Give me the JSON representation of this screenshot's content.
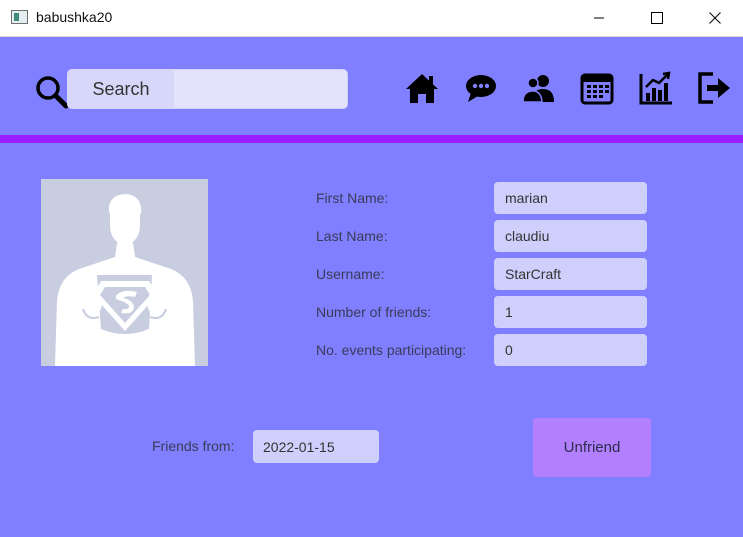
{
  "window": {
    "title": "babushka20"
  },
  "search": {
    "label": "Search",
    "value": ""
  },
  "nav": {
    "icons": [
      "home-icon",
      "chat-icon",
      "friends-icon",
      "calendar-icon",
      "stats-icon",
      "logout-icon"
    ]
  },
  "profile": {
    "fields": [
      {
        "label": "First Name:",
        "value": "marian"
      },
      {
        "label": "Last Name:",
        "value": "claudiu"
      },
      {
        "label": "Username:",
        "value": "StarCraft"
      },
      {
        "label": "Number of friends:",
        "value": "1"
      },
      {
        "label": "No. events participating:",
        "value": "0"
      }
    ]
  },
  "friendship": {
    "label": "Friends from:",
    "date": "2022-01-15"
  },
  "actions": {
    "unfriend_label": "Unfriend"
  },
  "colors": {
    "background": "#7f7fff",
    "divider": "#9a1dff",
    "field": "#cfcffc",
    "button": "#b280ff"
  }
}
